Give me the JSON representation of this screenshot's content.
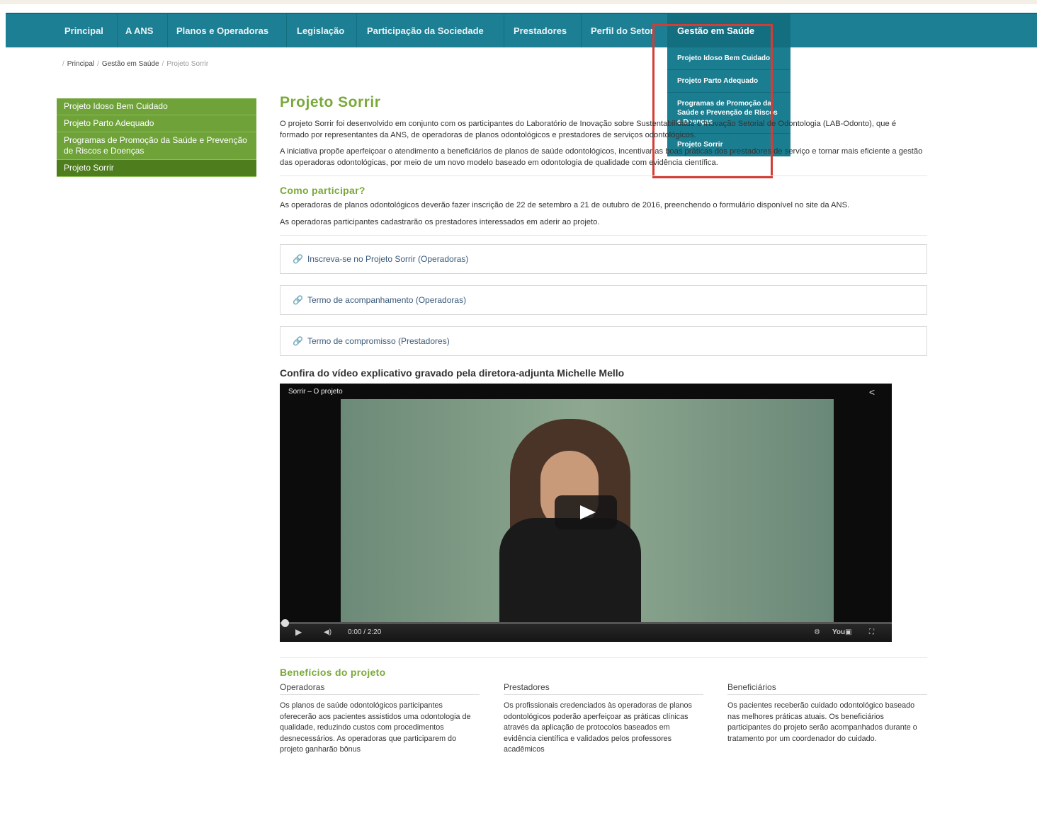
{
  "nav": {
    "items": [
      "Principal",
      "A ANS",
      "Planos e Operadoras",
      "Legislação",
      "Participação da Sociedade",
      "Prestadores",
      "Perfil do Setor",
      "Gestão em Saúde"
    ]
  },
  "dropdown": {
    "items": [
      "Projeto Idoso Bem Cuidado",
      "Projeto Parto Adequado",
      "Programas de Promoção da Saúde e Prevenção de Riscos e Doenças",
      "Projeto Sorrir"
    ]
  },
  "breadcrumb": [
    "Principal",
    "Gestão em Saúde",
    "Projeto Sorrir"
  ],
  "sidebar": {
    "items": [
      "Projeto Idoso Bem Cuidado",
      "Projeto Parto Adequado",
      "Programas de Promoção da Saúde e Prevenção de Riscos e Doenças",
      "Projeto Sorrir"
    ]
  },
  "main": {
    "title": "Projeto Sorrir",
    "intro1": "O projeto Sorrir foi desenvolvido em conjunto com os participantes do Laboratório de Inovação sobre Sustentabilidade e Inovação Setorial de Odontologia (LAB-Odonto), que é formado por representantes da ANS, de operadoras de planos odontológicos e prestadores de serviços odontológicos.",
    "intro2": "A iniciativa propõe aperfeiçoar o atendimento a beneficiários de planos de saúde odontológicos, incentivar as boas práticas dos prestadores de serviço e tornar mais eficiente a gestão das operadoras odontológicas, por meio de um novo modelo baseado em odontologia de qualidade com evidência científica.",
    "how_title": "Como participar?",
    "how1": "As operadoras de planos odontológicos deverão fazer inscrição de 22 de setembro a 21 de outubro de 2016, preenchendo o formulário disponível no site da ANS.",
    "how2": "As operadoras participantes cadastrarão os prestadores interessados em aderir ao projeto.",
    "links": [
      "Inscreva-se no Projeto Sorrir (Operadoras)",
      "Termo de acompanhamento (Operadoras)",
      "Termo de compromisso (Prestadores)"
    ],
    "video_caption": "Confira do vídeo explicativo gravado pela diretora-adjunta Michelle Mello",
    "video": {
      "title": "Sorrir – O projeto",
      "time": "0:00 / 2:20",
      "progress": 0
    },
    "benefits_title": "Benefícios do projeto",
    "benefits": [
      {
        "heading": "Operadoras",
        "text": "Os planos de saúde odontológicos participantes oferecerão aos pacientes assistidos uma odontologia de qualidade, reduzindo custos com procedimentos desnecessários. As operadoras que participarem do projeto ganharão bônus"
      },
      {
        "heading": "Prestadores",
        "text": "Os profissionais credenciados às operadoras de planos odontológicos poderão aperfeiçoar as práticas clínicas através da aplicação de protocolos baseados em evidência científica e validados pelos professores acadêmicos"
      },
      {
        "heading": "Beneficiários",
        "text": "Os pacientes receberão cuidado odontológico baseado nas melhores práticas atuais. Os beneficiários participantes do projeto serão acompanhados durante o tratamento por um coordenador do cuidado."
      }
    ]
  },
  "colors": {
    "nav": "#1d7f93",
    "sidebar": "#6fa33a",
    "sidebar_active": "#4d7d1c",
    "title": "#7aa93a",
    "highlight": "#d23d35"
  }
}
